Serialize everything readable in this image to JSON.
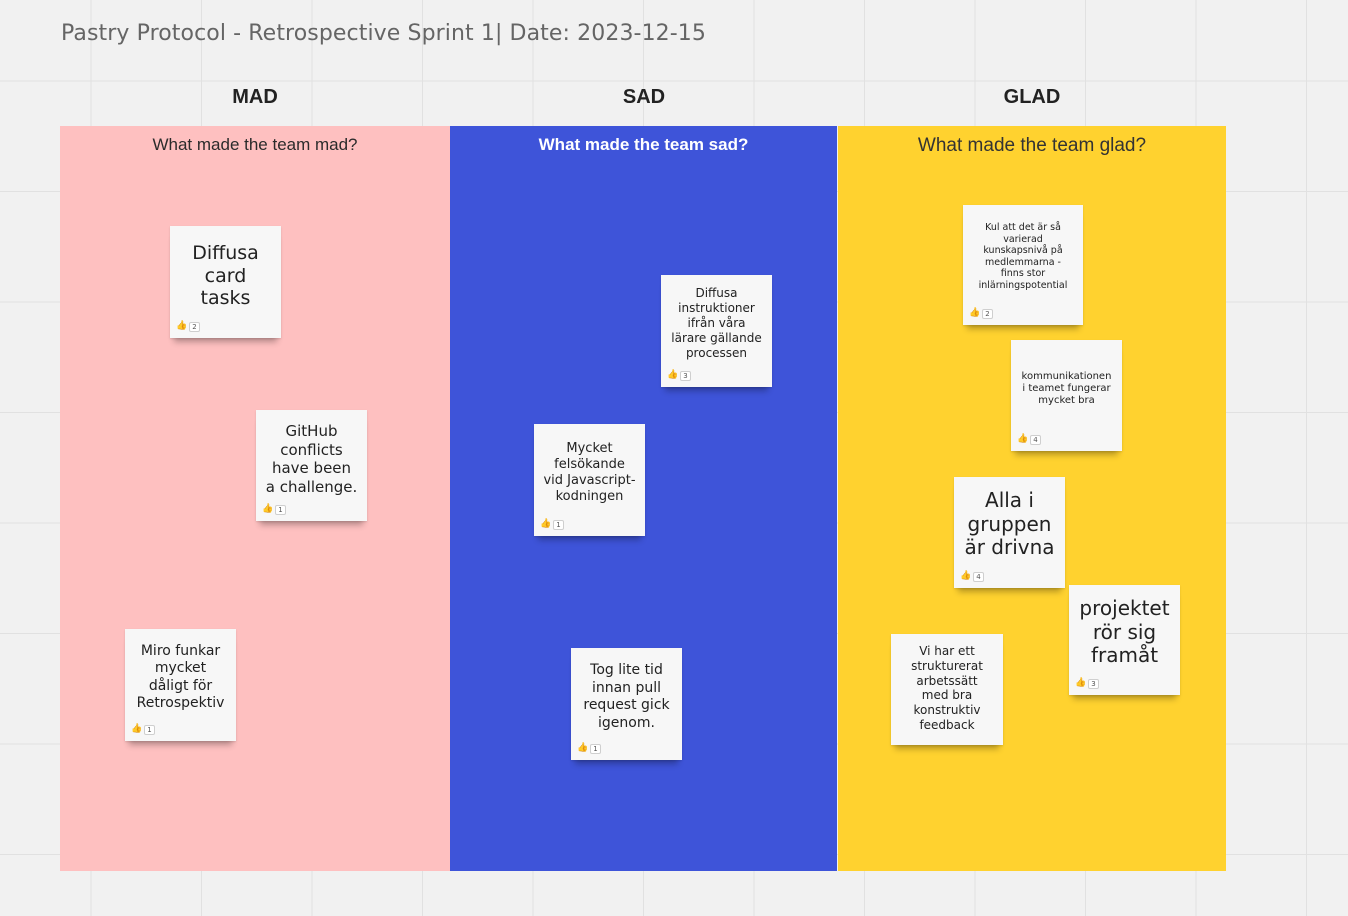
{
  "board": {
    "title": "Pastry Protocol - Retrospective Sprint 1| Date: 2023-12-15"
  },
  "columns": {
    "mad": {
      "heading": "MAD",
      "question": "What made the team mad?",
      "color": "#fec0c0"
    },
    "sad": {
      "heading": "SAD",
      "question": "What made the team sad?",
      "color": "#3e54d9"
    },
    "glad": {
      "heading": "GLAD",
      "question": "What made the team glad?",
      "color": "#ffd22f"
    }
  },
  "stickies": {
    "mad_1": {
      "text": "Diffusa\ncard\ntasks",
      "votes": "2"
    },
    "mad_2": {
      "text": "GitHub\nconflicts\nhave been\na challenge.",
      "votes": "1"
    },
    "mad_3": {
      "text": "Miro funkar\nmycket\ndåligt för\nRetrospektiv",
      "votes": "1"
    },
    "sad_1": {
      "text": "Diffusa\ninstruktioner\nifrån våra\nlärare gällande\nprocessen",
      "votes": "3"
    },
    "sad_2": {
      "text": "Mycket\nfelsökande\nvid Javascript-\nkodningen",
      "votes": "1"
    },
    "sad_3": {
      "text": "Tog lite tid\ninnan  pull\nrequest gick\nigenom.",
      "votes": "1"
    },
    "glad_1": {
      "text": "Kul att det är så\nvarierad\nkunskapsnivå på\nmedlemmarna -\nfinns stor\ninlärningspotential",
      "votes": "2"
    },
    "glad_2": {
      "text": "kommunikationen\ni teamet fungerar\nmycket bra",
      "votes": "4"
    },
    "glad_3": {
      "text": "Alla i\ngruppen\när drivna",
      "votes": "4"
    },
    "glad_4": {
      "text": "Vi har ett\nstrukturerat\narbetssätt\nmed bra\nkonstruktiv\nfeedback",
      "votes": ""
    },
    "glad_5": {
      "text": "projektet\nrör sig\nframåt",
      "votes": "3"
    }
  },
  "icons": {
    "vote": "thumbs-up-icon"
  }
}
